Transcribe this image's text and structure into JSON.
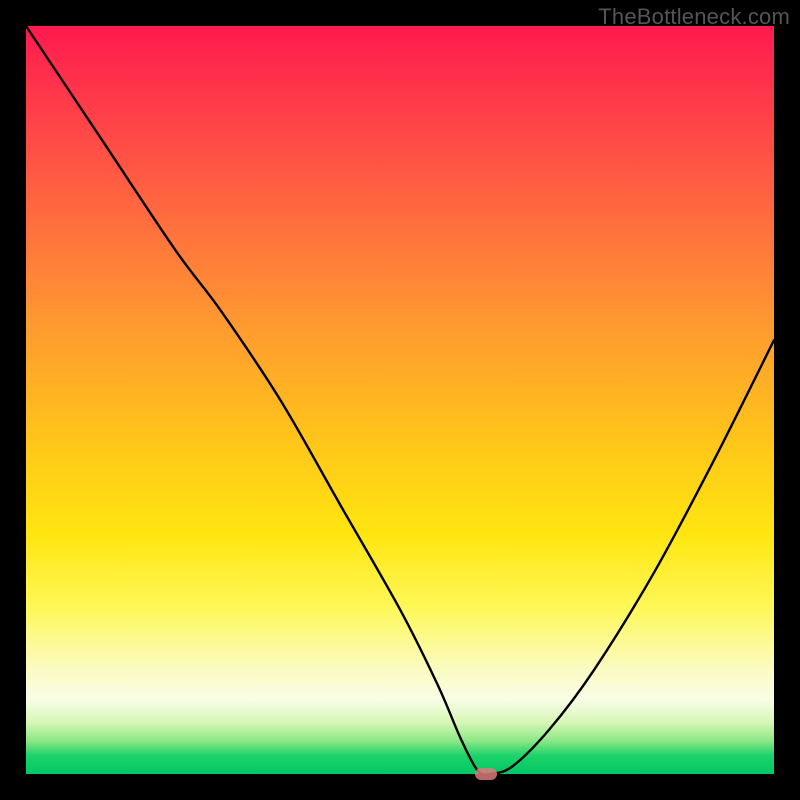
{
  "watermark": "TheBottleneck.com",
  "chart_data": {
    "type": "line",
    "title": "",
    "xlabel": "",
    "ylabel": "",
    "xlim": [
      0,
      100
    ],
    "ylim": [
      0,
      100
    ],
    "grid": false,
    "series": [
      {
        "name": "curve",
        "x": [
          0,
          10,
          20,
          26,
          34,
          42,
          50,
          55,
          58,
          60,
          61,
          62,
          65,
          70,
          76,
          84,
          92,
          100
        ],
        "y": [
          100,
          85,
          70,
          62,
          50,
          36,
          22,
          12,
          5,
          1,
          0,
          0,
          1,
          6,
          14,
          27,
          42,
          58
        ]
      }
    ],
    "marker": {
      "x": 61.5,
      "y": 0
    },
    "gradient_stops": [
      {
        "pos": 0,
        "color": "#ff1a4f"
      },
      {
        "pos": 0.55,
        "color": "#ffc41a"
      },
      {
        "pos": 0.86,
        "color": "#fbfbc2"
      },
      {
        "pos": 1.0,
        "color": "#00c765"
      }
    ]
  }
}
